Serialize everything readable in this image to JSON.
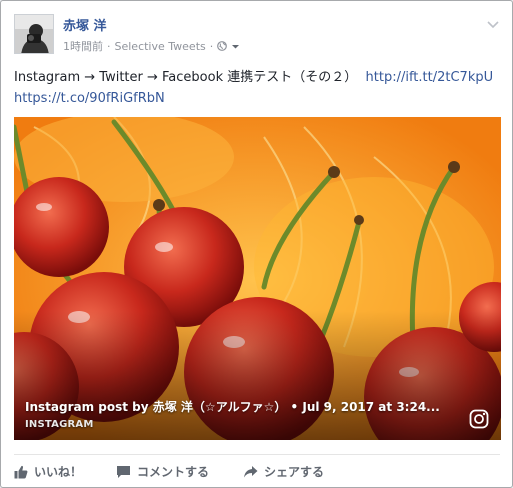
{
  "post": {
    "author": "赤塚 洋",
    "timestamp": "1時間前",
    "source_app": "Selective Tweets",
    "meta_separator": "·",
    "privacy_icon": "globe-icon",
    "message_text": "Instagram → Twitter → Facebook 連携テスト（その２）",
    "link_1": "http://ift.tt/2tC7kpU",
    "link_2": "https://t.co/90fRiGfRbN"
  },
  "attachment": {
    "title": "Instagram post by 赤塚 洋（☆アルファ☆） • Jul 9, 2017 at 3:24...",
    "source": "INSTAGRAM",
    "icon": "instagram-icon"
  },
  "actions": {
    "like_label": "いいね！",
    "comment_label": "コメントする",
    "share_label": "シェアする"
  },
  "colors": {
    "link": "#365899",
    "meta": "#90949c",
    "action": "#616770"
  }
}
